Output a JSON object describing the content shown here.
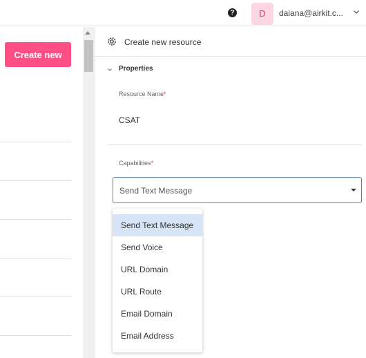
{
  "header": {
    "help_icon": "question-circle-icon",
    "help_glyph": "?",
    "avatar_initial": "D",
    "user_email": "daiana@airkit.c...",
    "user_menu_icon": "chevron-down-icon",
    "avatar_color": "#fcd7e3",
    "avatar_text_color": "#e0336e"
  },
  "left_panel": {
    "create_new_label": "Create new",
    "create_new_color": "#ff4f86"
  },
  "scrollbar": {
    "up_arrow_icon": "scroll-up-arrow-icon"
  },
  "resource_panel": {
    "title_icon": "resource-gear-icon",
    "title": "Create new resource",
    "section_icon": "chevron-down-icon",
    "section_title": "Properties",
    "resource_name": {
      "label": "Resource Name",
      "required_mark": "*",
      "value": "CSAT"
    },
    "capabilities": {
      "label": "Capabilities",
      "required_mark": "*",
      "selected_value": "Send Text Message",
      "caret_icon": "caret-down-icon",
      "border_color": "#5a7fa8"
    }
  },
  "capabilities_menu": {
    "selected_index": 0,
    "highlight_color": "#d6e4f6",
    "options": [
      "Send Text Message",
      "Send Voice",
      "URL Domain",
      "URL Route",
      "Email Domain",
      "Email Address"
    ]
  }
}
